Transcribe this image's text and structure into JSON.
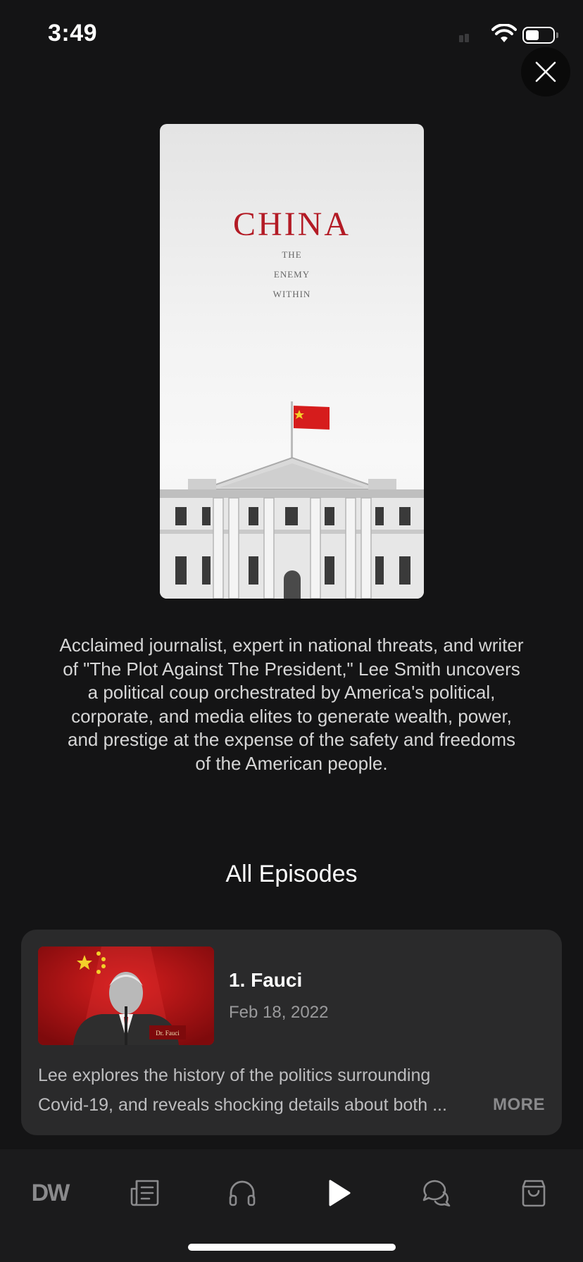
{
  "status_bar": {
    "time": "3:49"
  },
  "poster": {
    "title": "CHINA",
    "subtitle_lines": [
      "THE",
      "ENEMY",
      "WITHIN"
    ]
  },
  "description": "Acclaimed journalist, expert in national threats, and writer of \"The Plot Against The President,\" Lee Smith uncovers a political coup orchestrated by America's political, corporate, and media elites to generate wealth, power, and prestige at the expense of the safety and freedoms of the American people.",
  "section_title": "All Episodes",
  "episode": {
    "title": "1. Fauci",
    "date": "Feb 18, 2022",
    "thumb_caption": "Dr. Fauci",
    "desc_line1": "Lee explores the history of the politics surrounding",
    "desc_line2": "Covid-19, and reveals shocking details about both ...",
    "more_label": "MORE"
  },
  "tab_bar": {
    "logo_text": "DW",
    "active_tab": "watch"
  },
  "colors": {
    "background": "#141415",
    "card": "#2a2a2b",
    "poster_title": "#b31b25"
  }
}
